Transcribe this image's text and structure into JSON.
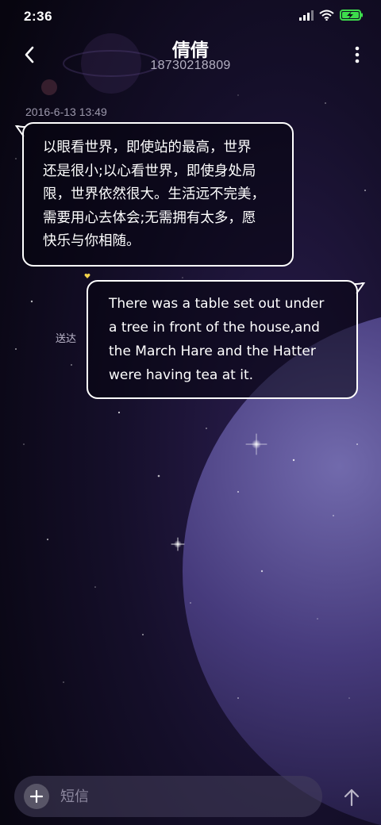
{
  "status_bar": {
    "time": "2:36",
    "icons": [
      "signal-icon",
      "wifi-icon",
      "battery-charging-icon"
    ],
    "battery_color": "#3ddc4c"
  },
  "header": {
    "contact_name": "倩倩",
    "contact_number": "18730218809",
    "icons": [
      "back-arrow-icon",
      "more-vertical-icon"
    ]
  },
  "conversation": {
    "timestamp": "2016-6-13 13:49",
    "messages": [
      {
        "direction": "incoming",
        "lines": [
          "以眼看世界，即使站的最高，世界",
          "还是很小;以心看世界，即使身处局",
          "限，世界依然很大。生活远不完美，",
          "需要用心去体会;无需拥有太多，愿",
          "快乐与你相随。"
        ]
      },
      {
        "direction": "outgoing",
        "lines": [
          "There was a table set out under",
          "a tree in front of the house,and",
          "the March Hare and the Hatter",
          "were having tea at it."
        ],
        "status": "送达"
      }
    ]
  },
  "composer": {
    "placeholder": "短信",
    "value": "",
    "icons": [
      "plus-icon",
      "send-arrow-icon"
    ]
  }
}
